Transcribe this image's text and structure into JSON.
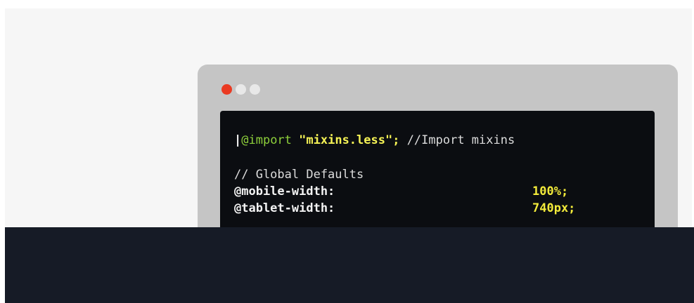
{
  "colors": {
    "background": "#f6f6f6",
    "window_frame": "#c5c5c5",
    "editor_background": "#0b0d11",
    "traffic_light_close": "#ea3a22",
    "traffic_light_other": "#e8e8e8",
    "keyword": "#8ed03b",
    "string": "#f5f255",
    "value": "#f2ea3a",
    "footer": "#161b26"
  },
  "window": {
    "traffic_lights": [
      "close",
      "minimize",
      "maximize"
    ]
  },
  "code": {
    "line1": {
      "caret": "|",
      "keyword": "@import",
      "string": "\"mixins.less\";",
      "comment": " //Import mixins"
    },
    "line2": {
      "comment": "// Global Defaults"
    },
    "line3": {
      "variable": "@mobile-width:",
      "value": "100%;"
    },
    "line4": {
      "variable": "@tablet-width:",
      "value": "740px;"
    }
  }
}
